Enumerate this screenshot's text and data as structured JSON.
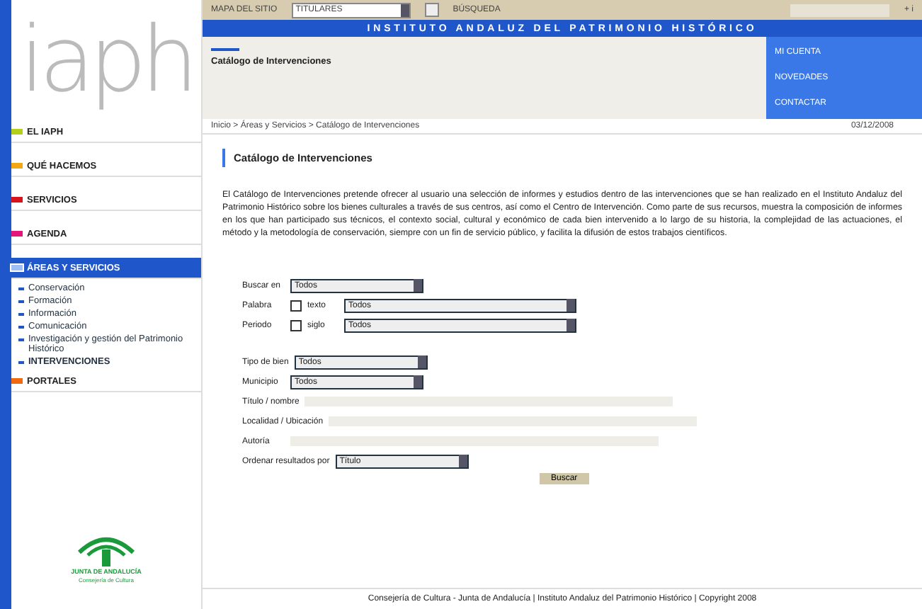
{
  "logo": {
    "text": "iaph"
  },
  "top_bar": {
    "link_left": "MAPA DEL SITIO",
    "select": "TITULARES",
    "link_right": "BÚSQUEDA",
    "end": "+ i"
  },
  "title_band": "INSTITUTO ANDALUZ DEL PATRIMONIO HISTÓRICO",
  "section_label": "Catálogo de Intervenciones",
  "right_menu": [
    "MI CUENTA",
    "NOVEDADES",
    "CONTACTAR"
  ],
  "breadcrumb": "Inicio > Áreas y Servicios > Catálogo de Intervenciones",
  "date": "03/12/2008",
  "sidebar": {
    "items": [
      {
        "label": "EL IAPH",
        "color": "#b5d01a",
        "selected": false
      },
      {
        "label": "QUÉ HACEMOS",
        "color": "#f3a712",
        "selected": false
      },
      {
        "label": "SERVICIOS",
        "color": "#d8141c",
        "selected": false
      },
      {
        "label": "AGENDA",
        "color": "#e6157c",
        "selected": false
      },
      {
        "label": "ÁREAS Y SERVICIOS",
        "color": "#9fc0f7",
        "selected": true,
        "children": [
          {
            "label": "Conservación",
            "selected": false
          },
          {
            "label": "Formación",
            "selected": false
          },
          {
            "label": "Información",
            "selected": false
          },
          {
            "label": "Comunicación",
            "selected": false
          },
          {
            "label": "Investigación y gestión del Patrimonio Histórico",
            "selected": false
          },
          {
            "label": "INTERVENCIONES",
            "selected": true
          }
        ]
      },
      {
        "label": "PORTALES",
        "color": "#f26a10",
        "selected": false
      }
    ]
  },
  "heading": "Catálogo de Intervenciones",
  "intro": "El Catálogo de Intervenciones pretende ofrecer al usuario una selección de informes y estudios dentro de las intervenciones que se han realizado en el Instituto Andaluz del Patrimonio Histórico sobre los bienes culturales a través de sus centros, así como el Centro de Intervención. Como parte de sus recursos, muestra la composición de informes en los que han participado sus técnicos, el contexto social, cultural y económico de cada bien intervenido a lo largo de su historia, la complejidad de las actuaciones, el método y la metodología de conservación, siempre con un fin de servicio público, y facilita la difusión de estos trabajos científicos.",
  "form": {
    "rows": [
      {
        "kind": "select",
        "label": "Buscar en",
        "value": "Todos"
      },
      {
        "kind": "check",
        "label": "Palabra",
        "check_label": "texto",
        "checked": false,
        "value": "Todos"
      },
      {
        "kind": "check",
        "label": "Periodo",
        "check_label": "siglo",
        "checked": false,
        "value": "Todos"
      },
      {
        "kind": "gap"
      },
      {
        "kind": "select",
        "label": "Tipo de bien",
        "value": "Todos"
      },
      {
        "kind": "select",
        "label": "Municipio",
        "value": "Todos"
      },
      {
        "kind": "text",
        "label": "Título / nombre"
      },
      {
        "kind": "text",
        "label": "Localidad / Ubicación"
      },
      {
        "kind": "text",
        "label": "Autoría"
      },
      {
        "kind": "select",
        "label": "Ordenar resultados por",
        "value": "Título"
      }
    ],
    "button": "Buscar"
  },
  "footer": "Consejería de Cultura - Junta de Andalucía | Instituto Andaluz del Patrimonio Histórico | Copyright 2008",
  "gov_logo": {
    "name": "JUNTA DE ANDALUCÍA",
    "subtitle": "Consejería de Cultura"
  }
}
